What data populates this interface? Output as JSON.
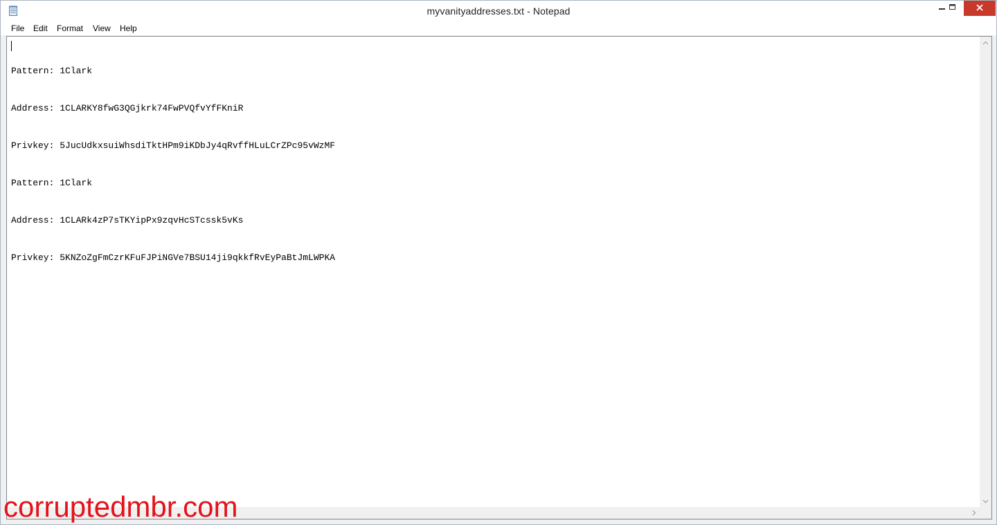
{
  "window": {
    "title": "myvanityaddresses.txt - Notepad"
  },
  "menu": {
    "items": [
      "File",
      "Edit",
      "Format",
      "View",
      "Help"
    ]
  },
  "editor": {
    "lines": [
      "Pattern: 1Clark",
      "Address: 1CLARKY8fwG3QGjkrk74FwPVQfvYfFKniR",
      "Privkey: 5JucUdkxsuiWhsdiTktHPm9iKDbJy4qRvffHLuLCrZPc95vWzMF",
      "Pattern: 1Clark",
      "Address: 1CLARk4zP7sTKYipPx9zqvHcSTcssk5vKs",
      "Privkey: 5KNZoZgFmCzrKFuFJPiNGVe7BSU14ji9qkkfRvEyPaBtJmLWPKA"
    ]
  },
  "watermark": {
    "text": "corruptedmbr.com"
  },
  "icons": {
    "app": "notepad-icon",
    "minimize": "minimize-icon",
    "maximize": "maximize-icon",
    "close": "close-icon"
  },
  "colors": {
    "close_button": "#c7392b",
    "watermark": "#e4121a",
    "window_border": "#a9b4c1"
  }
}
